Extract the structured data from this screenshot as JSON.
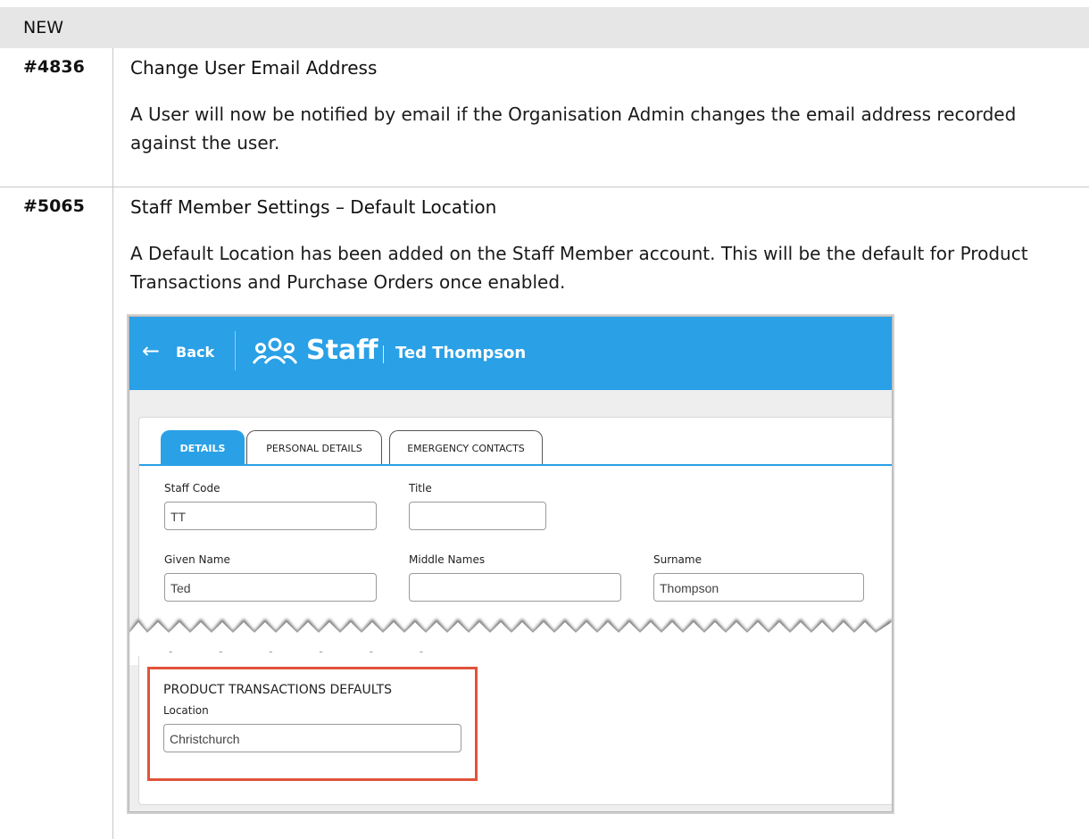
{
  "section": {
    "label": "NEW"
  },
  "items": [
    {
      "id": "#4836",
      "title": "Change User Email Address",
      "description": "A User will now be notified by email if the Organisation Admin changes the email address recorded against the user."
    },
    {
      "id": "#5065",
      "title": "Staff Member Settings – Default Location",
      "description": "A Default Location has been added on the Staff Member account. This will be the default for Product Transactions and Purchase Orders once enabled."
    }
  ],
  "screenshot": {
    "back_label": "Back",
    "page_title": "Staff",
    "record_name": "Ted Thompson",
    "bar_color": "#2aa0e6",
    "tabs": [
      {
        "label": "DETAILS",
        "active": true
      },
      {
        "label": "PERSONAL DETAILS",
        "active": false
      },
      {
        "label": "EMERGENCY CONTACTS",
        "active": false
      }
    ],
    "fields": {
      "staff_code": {
        "label": "Staff Code",
        "value": "TT"
      },
      "title": {
        "label": "Title",
        "value": ""
      },
      "given_name": {
        "label": "Given Name",
        "value": "Ted"
      },
      "middle_names": {
        "label": "Middle Names",
        "value": ""
      },
      "surname": {
        "label": "Surname",
        "value": "Thompson"
      }
    },
    "product_defaults": {
      "heading": "PRODUCT TRANSACTIONS DEFAULTS",
      "location_label": "Location",
      "location_value": "Christchurch"
    },
    "highlight_color": "#e0533a"
  }
}
